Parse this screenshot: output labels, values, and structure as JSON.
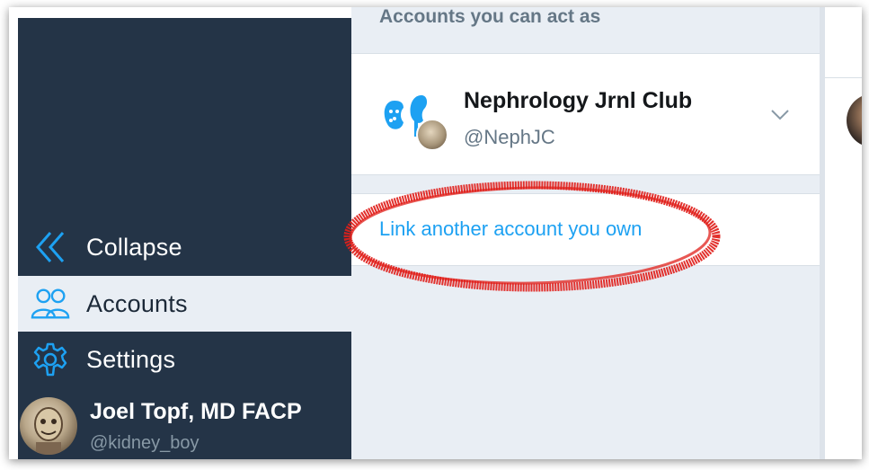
{
  "sidebar": {
    "collapse_label": "Collapse",
    "accounts_label": "Accounts",
    "settings_label": "Settings",
    "profile": {
      "name": "Joel Topf, MD FACP",
      "handle": "@kidney_boy"
    }
  },
  "panel": {
    "header": "Accounts you can act as",
    "account": {
      "name": "Nephrology Jrnl Club",
      "handle": "@NephJC"
    },
    "link_label": "Link another account you own"
  },
  "colors": {
    "sidebar_bg": "#243447",
    "accent_blue": "#1da1f2",
    "annotation_red": "#e0201b"
  },
  "icons": {
    "collapse": "double-chevron-left-icon",
    "accounts": "people-icon",
    "settings": "gear-icon",
    "account_menu": "chevron-down-icon"
  }
}
